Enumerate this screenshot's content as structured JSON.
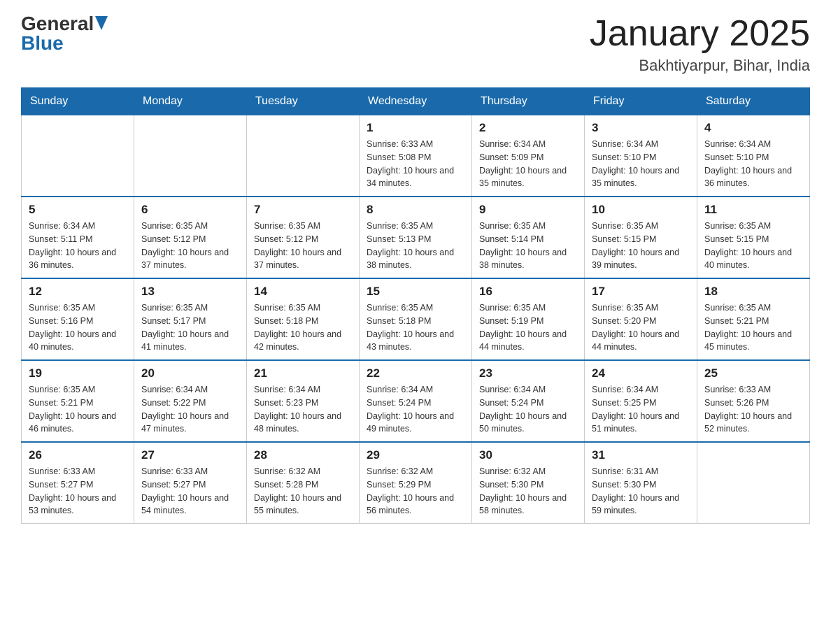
{
  "header": {
    "logo": {
      "general": "General",
      "blue": "Blue",
      "arrow": "▶"
    },
    "title": "January 2025",
    "location": "Bakhtiyarpur, Bihar, India"
  },
  "calendar": {
    "days_of_week": [
      "Sunday",
      "Monday",
      "Tuesday",
      "Wednesday",
      "Thursday",
      "Friday",
      "Saturday"
    ],
    "weeks": [
      [
        {
          "day": "",
          "info": ""
        },
        {
          "day": "",
          "info": ""
        },
        {
          "day": "",
          "info": ""
        },
        {
          "day": "1",
          "info": "Sunrise: 6:33 AM\nSunset: 5:08 PM\nDaylight: 10 hours and 34 minutes."
        },
        {
          "day": "2",
          "info": "Sunrise: 6:34 AM\nSunset: 5:09 PM\nDaylight: 10 hours and 35 minutes."
        },
        {
          "day": "3",
          "info": "Sunrise: 6:34 AM\nSunset: 5:10 PM\nDaylight: 10 hours and 35 minutes."
        },
        {
          "day": "4",
          "info": "Sunrise: 6:34 AM\nSunset: 5:10 PM\nDaylight: 10 hours and 36 minutes."
        }
      ],
      [
        {
          "day": "5",
          "info": "Sunrise: 6:34 AM\nSunset: 5:11 PM\nDaylight: 10 hours and 36 minutes."
        },
        {
          "day": "6",
          "info": "Sunrise: 6:35 AM\nSunset: 5:12 PM\nDaylight: 10 hours and 37 minutes."
        },
        {
          "day": "7",
          "info": "Sunrise: 6:35 AM\nSunset: 5:12 PM\nDaylight: 10 hours and 37 minutes."
        },
        {
          "day": "8",
          "info": "Sunrise: 6:35 AM\nSunset: 5:13 PM\nDaylight: 10 hours and 38 minutes."
        },
        {
          "day": "9",
          "info": "Sunrise: 6:35 AM\nSunset: 5:14 PM\nDaylight: 10 hours and 38 minutes."
        },
        {
          "day": "10",
          "info": "Sunrise: 6:35 AM\nSunset: 5:15 PM\nDaylight: 10 hours and 39 minutes."
        },
        {
          "day": "11",
          "info": "Sunrise: 6:35 AM\nSunset: 5:15 PM\nDaylight: 10 hours and 40 minutes."
        }
      ],
      [
        {
          "day": "12",
          "info": "Sunrise: 6:35 AM\nSunset: 5:16 PM\nDaylight: 10 hours and 40 minutes."
        },
        {
          "day": "13",
          "info": "Sunrise: 6:35 AM\nSunset: 5:17 PM\nDaylight: 10 hours and 41 minutes."
        },
        {
          "day": "14",
          "info": "Sunrise: 6:35 AM\nSunset: 5:18 PM\nDaylight: 10 hours and 42 minutes."
        },
        {
          "day": "15",
          "info": "Sunrise: 6:35 AM\nSunset: 5:18 PM\nDaylight: 10 hours and 43 minutes."
        },
        {
          "day": "16",
          "info": "Sunrise: 6:35 AM\nSunset: 5:19 PM\nDaylight: 10 hours and 44 minutes."
        },
        {
          "day": "17",
          "info": "Sunrise: 6:35 AM\nSunset: 5:20 PM\nDaylight: 10 hours and 44 minutes."
        },
        {
          "day": "18",
          "info": "Sunrise: 6:35 AM\nSunset: 5:21 PM\nDaylight: 10 hours and 45 minutes."
        }
      ],
      [
        {
          "day": "19",
          "info": "Sunrise: 6:35 AM\nSunset: 5:21 PM\nDaylight: 10 hours and 46 minutes."
        },
        {
          "day": "20",
          "info": "Sunrise: 6:34 AM\nSunset: 5:22 PM\nDaylight: 10 hours and 47 minutes."
        },
        {
          "day": "21",
          "info": "Sunrise: 6:34 AM\nSunset: 5:23 PM\nDaylight: 10 hours and 48 minutes."
        },
        {
          "day": "22",
          "info": "Sunrise: 6:34 AM\nSunset: 5:24 PM\nDaylight: 10 hours and 49 minutes."
        },
        {
          "day": "23",
          "info": "Sunrise: 6:34 AM\nSunset: 5:24 PM\nDaylight: 10 hours and 50 minutes."
        },
        {
          "day": "24",
          "info": "Sunrise: 6:34 AM\nSunset: 5:25 PM\nDaylight: 10 hours and 51 minutes."
        },
        {
          "day": "25",
          "info": "Sunrise: 6:33 AM\nSunset: 5:26 PM\nDaylight: 10 hours and 52 minutes."
        }
      ],
      [
        {
          "day": "26",
          "info": "Sunrise: 6:33 AM\nSunset: 5:27 PM\nDaylight: 10 hours and 53 minutes."
        },
        {
          "day": "27",
          "info": "Sunrise: 6:33 AM\nSunset: 5:27 PM\nDaylight: 10 hours and 54 minutes."
        },
        {
          "day": "28",
          "info": "Sunrise: 6:32 AM\nSunset: 5:28 PM\nDaylight: 10 hours and 55 minutes."
        },
        {
          "day": "29",
          "info": "Sunrise: 6:32 AM\nSunset: 5:29 PM\nDaylight: 10 hours and 56 minutes."
        },
        {
          "day": "30",
          "info": "Sunrise: 6:32 AM\nSunset: 5:30 PM\nDaylight: 10 hours and 58 minutes."
        },
        {
          "day": "31",
          "info": "Sunrise: 6:31 AM\nSunset: 5:30 PM\nDaylight: 10 hours and 59 minutes."
        },
        {
          "day": "",
          "info": ""
        }
      ]
    ]
  }
}
